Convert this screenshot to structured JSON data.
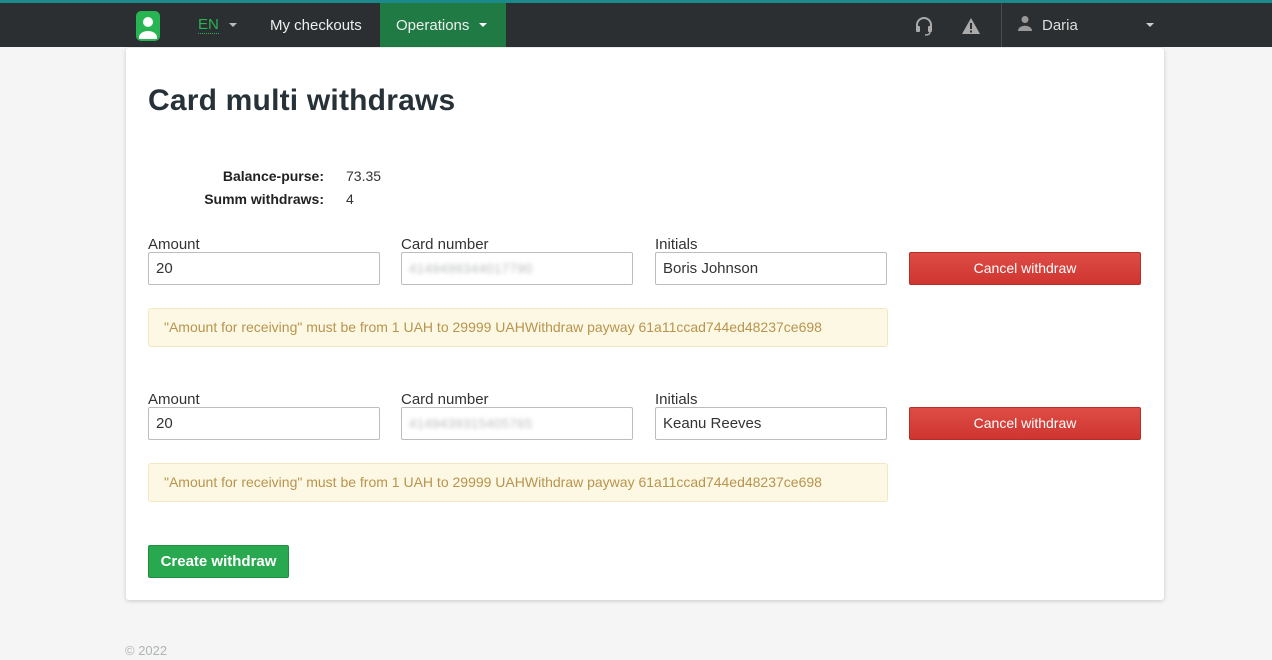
{
  "nav": {
    "lang": "EN",
    "my_checkouts": "My checkouts",
    "operations": "Operations",
    "user": "Daria",
    "icons": [
      "headset-icon",
      "warning-icon",
      "user-icon"
    ],
    "colors": {
      "bar": "#2c2f31",
      "accent": "#27b553",
      "active": "#1f7a43"
    }
  },
  "page": {
    "title": "Card multi withdraws",
    "summary": {
      "balance_label": "Balance-purse:",
      "balance_value": "73.35",
      "withdraws_label": "Summ withdraws:",
      "withdraws_value": "4"
    },
    "labels": {
      "amount": "Amount",
      "card": "Card number",
      "initials": "Initials",
      "cancel": "Cancel withdraw"
    },
    "withdraws": [
      {
        "amount": "20",
        "card": "4149499344017790",
        "initials": "Boris Johnson",
        "error": "\"Amount for receiving\" must be from 1 UAH to 29999 UAHWithdraw payway 61a11ccad744ed48237ce698"
      },
      {
        "amount": "20",
        "card": "4149439315405765",
        "initials": "Keanu Reeves",
        "error": "\"Amount for receiving\" must be from 1 UAH to 29999 UAHWithdraw payway 61a11ccad744ed48237ce698"
      }
    ],
    "create_button": "Create withdraw"
  },
  "footer": "© 2022"
}
